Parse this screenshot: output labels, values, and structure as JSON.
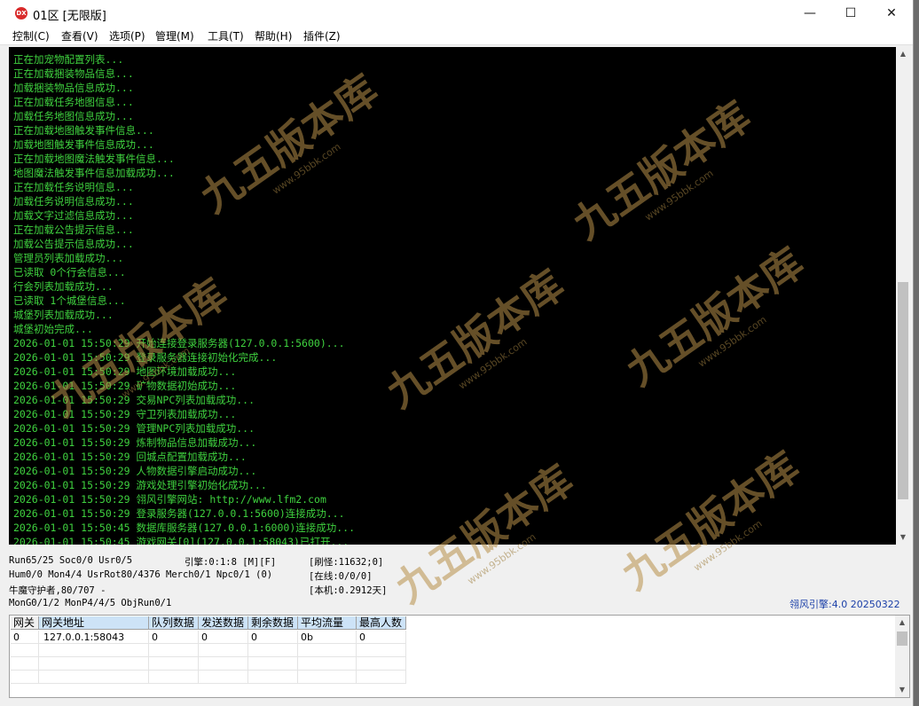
{
  "window": {
    "title": "01区 [无限版]",
    "icon_text": "DX",
    "minimize": "—",
    "maximize": "☐",
    "close": "✕"
  },
  "menu": [
    "控制(C)",
    "查看(V)",
    "选项(P)",
    "管理(M)",
    "工具(T)",
    "帮助(H)",
    "插件(Z)"
  ],
  "log_lines": [
    "正在加宠物配置列表...",
    "正在加载捆装物品信息...",
    "加载捆装物品信息成功...",
    "正在加载任务地图信息...",
    "加载任务地图信息成功...",
    "正在加载地图触发事件信息...",
    "加载地图触发事件信息成功...",
    "正在加载地图魔法触发事件信息...",
    "地图魔法触发事件信息加载成功...",
    "正在加载任务说明信息...",
    "加载任务说明信息成功...",
    "加载文字过滤信息成功...",
    "正在加载公告提示信息...",
    "加载公告提示信息成功...",
    "管理员列表加载成功...",
    "已读取 0个行会信息...",
    "行会列表加载成功...",
    "已读取 1个城堡信息...",
    "城堡列表加载成功...",
    "城堡初始完成...",
    "2026-01-01 15:50:29 开始连接登录服务器(127.0.0.1:5600)...",
    "2026-01-01 15:50:29 登录服务器连接初始化完成...",
    "2026-01-01 15:50:29 地图环境加载成功...",
    "2026-01-01 15:50:29 矿物数据初始成功...",
    "2026-01-01 15:50:29 交易NPC列表加载成功...",
    "2026-01-01 15:50:29 守卫列表加载成功...",
    "2026-01-01 15:50:29 管理NPC列表加载成功...",
    "2026-01-01 15:50:29 炼制物品信息加载成功...",
    "2026-01-01 15:50:29 回城点配置加载成功...",
    "2026-01-01 15:50:29 人物数据引擎启动成功...",
    "2026-01-01 15:50:29 游戏处理引擎初始化成功...",
    "2026-01-01 15:50:29 翎风引擎网站: http://www.lfm2.com",
    "2026-01-01 15:50:29 登录服务器(127.0.0.1:5600)连接成功...",
    "2026-01-01 15:50:45 数据库服务器(127.0.0.1:6000)连接成功...",
    "2026-01-01 15:50:45 游戏网关[0](127.0.0.1:58043)已打开..."
  ],
  "status": {
    "run": "Run65/25 Soc0/0 Usr0/5",
    "engine": "引擎:0:1:8 [M][F]",
    "refresh": "[刷怪:11632;0]",
    "hum": "Hum0/0 Mon4/4 UsrRot80/4376 Merch0/1 Npc0/1 (0)",
    "online": "[在线:0/0/0]",
    "guardian": "牛魔守护者,80/707 -",
    "local": "[本机:0.2912天]",
    "mongen": "MonG0/1/2 MonP4/4/5 ObjRun0/1",
    "engine_version": "翎风引擎:4.0 20250322"
  },
  "gate_table": {
    "headers": [
      "网关",
      "网关地址",
      "队列数据",
      "发送数据",
      "剩余数据",
      "平均流量",
      "最高人数"
    ],
    "rows": [
      [
        "0",
        "127.0.0.1:58043",
        "0",
        "0",
        "0",
        "0b",
        "0"
      ]
    ]
  },
  "watermark": {
    "text": "九五版本库",
    "url": "www.95bbk.com"
  }
}
